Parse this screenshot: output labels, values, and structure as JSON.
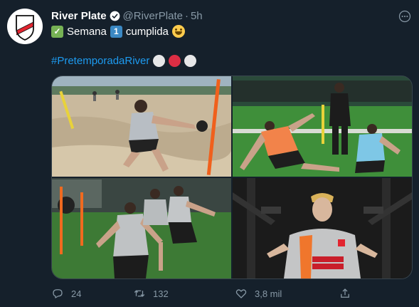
{
  "tweet": {
    "author_name": "River Plate",
    "handle": "@RiverPlate",
    "separator": "·",
    "time": "5h",
    "line1": {
      "text_a": "Semana",
      "number": "1",
      "text_b": "cumplida"
    },
    "hashtag": "#PretemporadaRiver",
    "photos": [
      "beach-training",
      "field-drill-duel",
      "cone-sprint-drill",
      "gym-machine"
    ],
    "stats": {
      "replies": "24",
      "retweets": "132",
      "likes": "3,8 mil"
    }
  },
  "colors": {
    "background": "#15202b",
    "link": "#1d9bf0",
    "muted": "#8899a6",
    "club_red": "#e2242f"
  }
}
